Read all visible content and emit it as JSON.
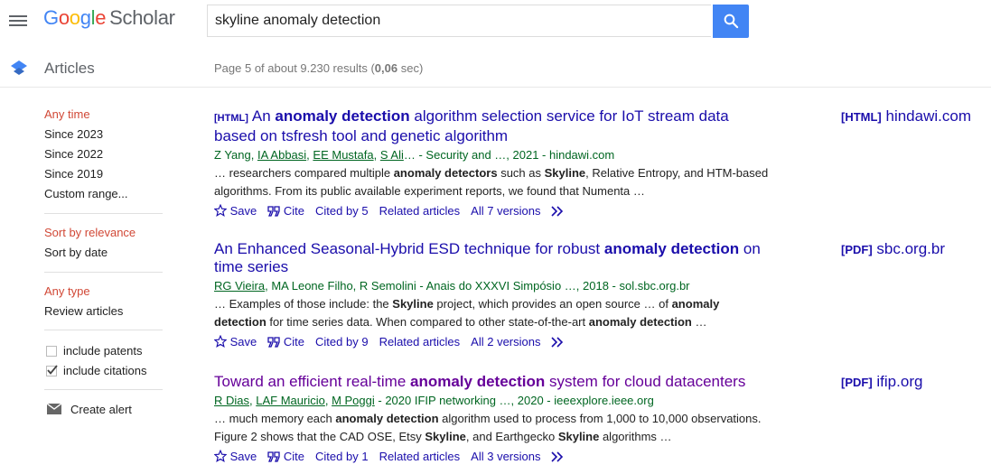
{
  "header": {
    "logo": {
      "google": [
        "G",
        "o",
        "o",
        "g",
        "l",
        "e"
      ],
      "scholar": "Scholar"
    },
    "search": {
      "value": "skyline anomaly detection"
    },
    "menu_icon": "hamburger-menu-icon",
    "search_icon": "search-icon",
    "accent_color": "#4285f4"
  },
  "subheader": {
    "section": "Articles",
    "results_prefix": "Page 5 of about 9.230 results (",
    "results_time": "0,06",
    "results_suffix": " sec)"
  },
  "sidebar": {
    "time": [
      "Any time",
      "Since 2023",
      "Since 2022",
      "Since 2019",
      "Custom range..."
    ],
    "sort": [
      "Sort by relevance",
      "Sort by date"
    ],
    "type": [
      "Any type",
      "Review articles"
    ],
    "include_patents": "include patents",
    "include_citations": "include citations",
    "create_alert": "Create alert",
    "active_color": "#d14836"
  },
  "results": [
    {
      "tag": "[HTML]",
      "title": [
        {
          "t": "An "
        },
        {
          "t": "anomaly detection",
          "b": true
        },
        {
          "t": " algorithm selection service for IoT stream data based on tsfresh tool and genetic algorithm"
        }
      ],
      "authors": [
        {
          "t": "Z Yang"
        },
        {
          "t": ", "
        },
        {
          "t": "IA Abbasi",
          "link": true
        },
        {
          "t": ", "
        },
        {
          "t": "EE Mustafa",
          "link": true
        },
        {
          "t": ", "
        },
        {
          "t": "S Ali",
          "link": true
        },
        {
          "t": "… - Security and …, 2021 - hindawi.com"
        }
      ],
      "snippet": [
        {
          "t": "… researchers compared multiple "
        },
        {
          "t": "anomaly detectors",
          "b": true
        },
        {
          "t": " such as "
        },
        {
          "t": "Skyline",
          "b": true
        },
        {
          "t": ", Relative Entropy, and HTM-based algorithms. From its public available experiment reports, we found that Numenta …"
        }
      ],
      "actions": {
        "save": "Save",
        "cite": "Cite",
        "cited_by": "Cited by 5",
        "related": "Related articles",
        "versions": "All 7 versions"
      },
      "side": {
        "tag": "[HTML]",
        "domain": "hindawi.com"
      }
    },
    {
      "tag": "",
      "title": [
        {
          "t": "An Enhanced Seasonal-Hybrid ESD technique for robust "
        },
        {
          "t": "anomaly detection",
          "b": true
        },
        {
          "t": " on time series"
        }
      ],
      "authors": [
        {
          "t": "RG Vieira",
          "link": true
        },
        {
          "t": ", MA Leone Filho, R Semolini - Anais do XXXVI Simpósio …, 2018 - sol.sbc.org.br"
        }
      ],
      "snippet": [
        {
          "t": "… Examples of those include: the "
        },
        {
          "t": "Skyline",
          "b": true
        },
        {
          "t": " project, which provides an open source … of "
        },
        {
          "t": "anomaly detection",
          "b": true
        },
        {
          "t": " for time series data. When compared to other state-of-the-art "
        },
        {
          "t": "anomaly detection",
          "b": true
        },
        {
          "t": " …"
        }
      ],
      "actions": {
        "save": "Save",
        "cite": "Cite",
        "cited_by": "Cited by 9",
        "related": "Related articles",
        "versions": "All 2 versions"
      },
      "side": {
        "tag": "[PDF]",
        "domain": "sbc.org.br"
      }
    },
    {
      "tag": "",
      "visited": true,
      "title": [
        {
          "t": "Toward an efficient real-time "
        },
        {
          "t": "anomaly detection",
          "b": true
        },
        {
          "t": " system for cloud datacenters"
        }
      ],
      "authors": [
        {
          "t": "R Dias",
          "link": true
        },
        {
          "t": ", "
        },
        {
          "t": "LAF Mauricio",
          "link": true
        },
        {
          "t": ", "
        },
        {
          "t": "M Poggi",
          "link": true
        },
        {
          "t": " - 2020 IFIP networking …, 2020 - ieeexplore.ieee.org"
        }
      ],
      "snippet": [
        {
          "t": "… much memory each "
        },
        {
          "t": "anomaly detection",
          "b": true
        },
        {
          "t": " algorithm used to process from 1,000 to 10,000 observations. Figure 2 shows that the CAD OSE, Etsy "
        },
        {
          "t": "Skyline",
          "b": true
        },
        {
          "t": ", and Earthgecko "
        },
        {
          "t": "Skyline",
          "b": true
        },
        {
          "t": " algorithms …"
        }
      ],
      "actions": {
        "save": "Save",
        "cite": "Cite",
        "cited_by": "Cited by 1",
        "related": "Related articles",
        "versions": "All 3 versions"
      },
      "side": {
        "tag": "[PDF]",
        "domain": "ifip.org"
      }
    }
  ]
}
